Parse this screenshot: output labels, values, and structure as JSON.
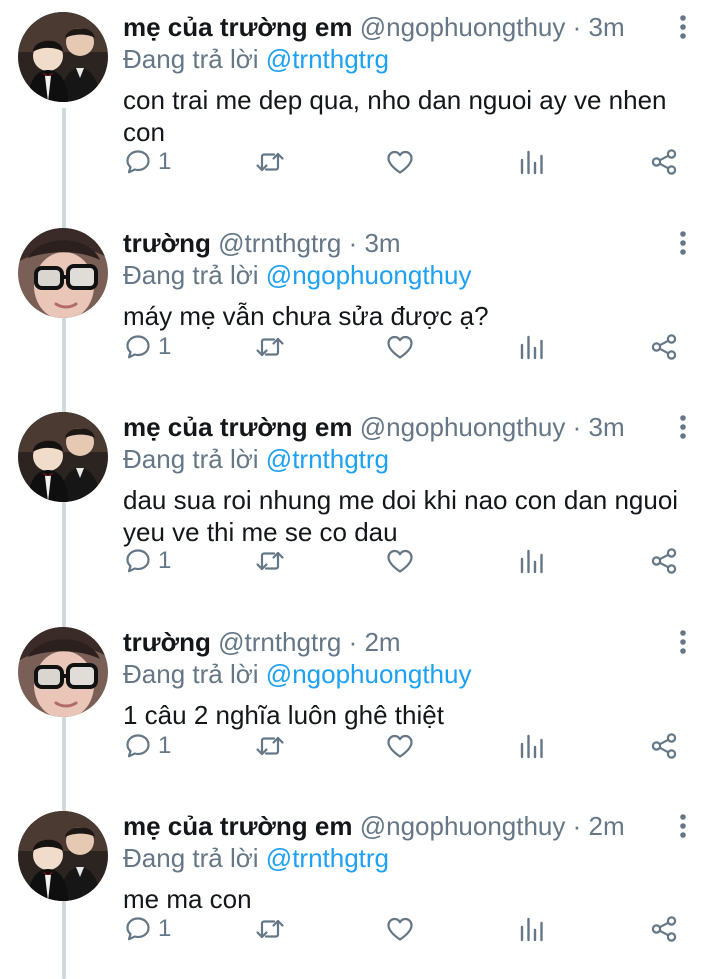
{
  "thread": {
    "tweets": [
      {
        "author": "mẹ của trường em",
        "handle": "@ngophuongthuy",
        "separator": "·",
        "time": "3m",
        "replying_label": "Đang trả lời",
        "replying_to": "@trnthgtrg",
        "text": "con trai me dep qua, nho dan nguoi ay ve nhen con",
        "reply_count": "1",
        "avatar": "two-boys-avatar"
      },
      {
        "author": "trường",
        "handle": "@trnthgtrg",
        "separator": "·",
        "time": "3m",
        "replying_label": "Đang trả lời",
        "replying_to": "@ngophuongthuy",
        "text": "máy mẹ vẫn chưa sửa được ạ?",
        "reply_count": "1",
        "avatar": "glasses-person-avatar"
      },
      {
        "author": "mẹ của trường em",
        "handle": "@ngophuongthuy",
        "separator": "·",
        "time": "3m",
        "replying_label": "Đang trả lời",
        "replying_to": "@trnthgtrg",
        "text": "dau sua roi nhung me doi khi nao con dan nguoi yeu ve thi me se co dau",
        "reply_count": "1",
        "avatar": "two-boys-avatar"
      },
      {
        "author": "trường",
        "handle": "@trnthgtrg",
        "separator": "·",
        "time": "2m",
        "replying_label": "Đang trả lời",
        "replying_to": "@ngophuongthuy",
        "text": "1 câu 2 nghĩa luôn ghê thiệt",
        "reply_count": "1",
        "avatar": "glasses-person-avatar"
      },
      {
        "author": "mẹ của trường em",
        "handle": "@ngophuongthuy",
        "separator": "·",
        "time": "2m",
        "replying_label": "Đang trả lời",
        "replying_to": "@trnthgtrg",
        "text": "me ma con",
        "reply_count": "1",
        "avatar": "two-boys-avatar"
      }
    ]
  },
  "icons": {
    "reply": "reply-icon",
    "retweet": "retweet-icon",
    "like": "like-heart-icon",
    "analytics": "analytics-icon",
    "share": "share-icon",
    "more": "more-vertical-icon"
  },
  "colors": {
    "text": "#14171a",
    "secondary": "#657786",
    "link": "#1da1f2",
    "thread_line": "#cfd9de"
  }
}
